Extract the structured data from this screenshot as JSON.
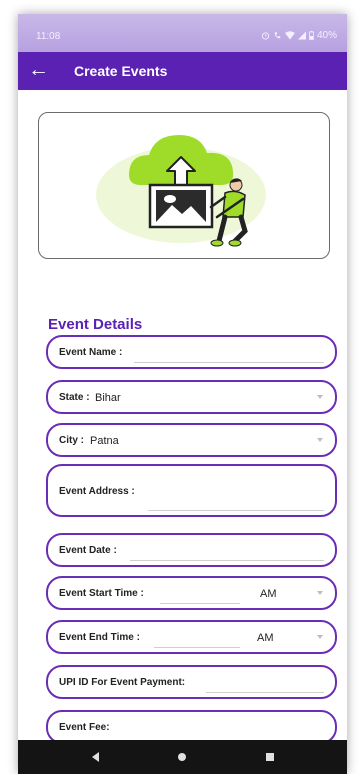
{
  "status_bar": {
    "time": "11:08",
    "battery": "40%"
  },
  "app_bar": {
    "title": "Create Events"
  },
  "image_card": {
    "illustration": "upload-photo-illustration"
  },
  "section_title": "Event Details",
  "fields": {
    "event_name": {
      "label": "Event Name :",
      "value": ""
    },
    "state": {
      "label": "State :",
      "value": "Bihar"
    },
    "city": {
      "label": "City :",
      "value": "Patna"
    },
    "event_address": {
      "label": "Event Address :",
      "value": ""
    },
    "event_date": {
      "label": "Event Date :",
      "value": ""
    },
    "event_start_time": {
      "label": "Event Start Time :",
      "value": "",
      "ampm": "AM"
    },
    "event_end_time": {
      "label": "Event End Time :",
      "value": "",
      "ampm": "AM"
    },
    "upi_id": {
      "label": "UPI ID For Event Payment:",
      "value": ""
    },
    "event_fee": {
      "label": "Event Fee:",
      "value": ""
    }
  },
  "nav_bar": {
    "icons": [
      "back-icon",
      "home-icon",
      "recents-icon"
    ]
  },
  "colors": {
    "primary": "#5a21b2",
    "field_border": "#6a2db5",
    "illustration_green": "#9fdc2a"
  }
}
